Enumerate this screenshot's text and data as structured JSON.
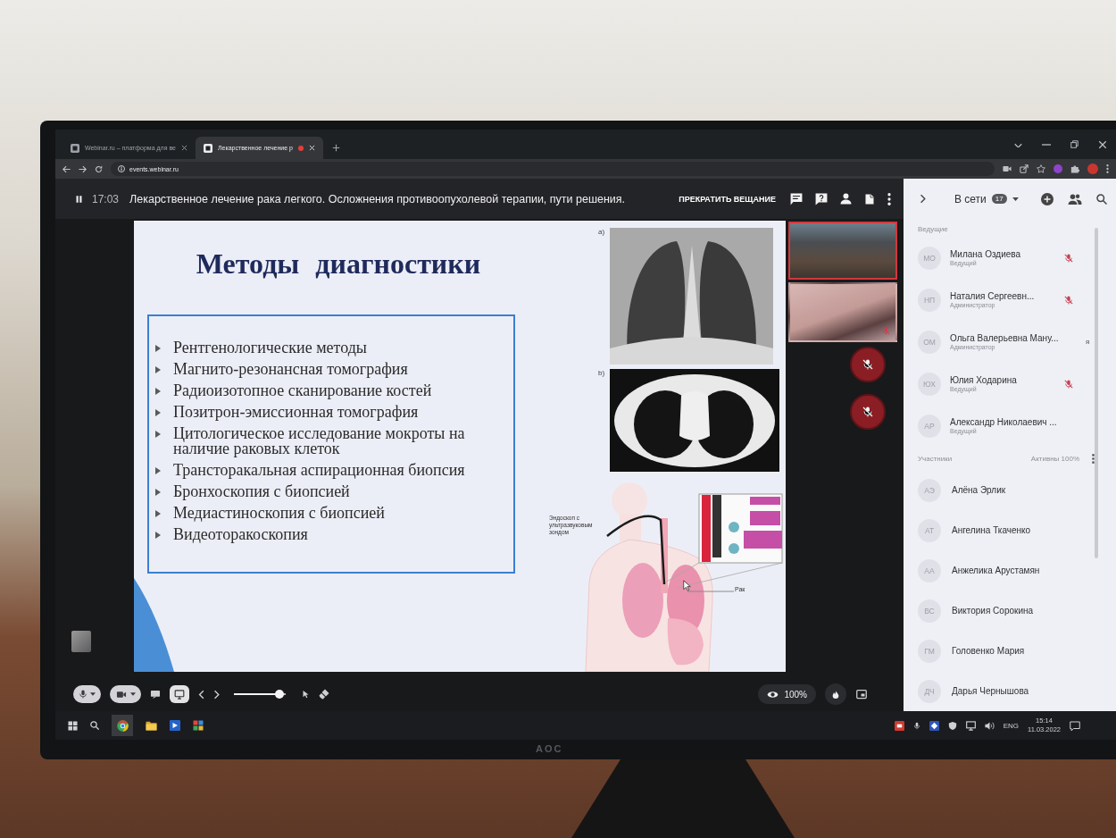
{
  "monitor": {
    "brand": "AOC"
  },
  "browser": {
    "tabs": [
      {
        "title": "Webinar.ru – платформа для ве",
        "selected": false,
        "recording": false
      },
      {
        "title": "Лекарственное лечение р",
        "selected": true,
        "recording": true
      }
    ],
    "address": "events.webinar.ru"
  },
  "top_bar": {
    "time": "17:03",
    "title": "Лекарственное лечение рака легкого. Осложнения противоопухолевой терапии, пути решения.",
    "stop_button": "ПРЕКРАТИТЬ ВЕЩАНИЕ"
  },
  "slide": {
    "title": "Методы диагностики",
    "bullets": [
      "Рентгенологические методы",
      "Магнито-резонансная томография",
      "Радиоизотопное сканирование костей",
      "Позитрон-эмиссионная томография",
      "Цитологическое исследование мокроты на наличие раковых клеток",
      "Трансторакальная аспирационная биопсия",
      "Бронхоскопия с биопсией",
      "Медиастиноскопия с биопсией",
      "Видеоторакоскопия"
    ],
    "figures": [
      {
        "kind": "xray",
        "label": "a)"
      },
      {
        "kind": "ct",
        "label": "b)"
      }
    ],
    "illustration": {
      "endoscope_label": "Эндоскоп с ультразвуковым зондом",
      "tumor_label": "Рак"
    }
  },
  "video_tiles": [
    {
      "kind": "video",
      "speaking": true,
      "mic_muted": false
    },
    {
      "kind": "video",
      "speaking": false,
      "mic_muted": true
    },
    {
      "kind": "audio",
      "speaking": false,
      "mic_muted": true
    },
    {
      "kind": "audio",
      "speaking": false,
      "mic_muted": true
    }
  ],
  "controls": {
    "slider": {
      "level": 0.95
    },
    "view_percent": "100%"
  },
  "sidebar": {
    "online_label": "В сети",
    "online_count": "17",
    "hosts_heading": "Ведущие",
    "hosts": [
      {
        "initials": "МО",
        "name": "Милана Оздиева",
        "role": "Ведущий",
        "mic_muted": true
      },
      {
        "initials": "НП",
        "name": "Наталия Сергеевн...",
        "role": "Администратор",
        "mic_muted": true
      },
      {
        "initials": "ОМ",
        "name": "Ольга Валерьевна Ману...",
        "role": "Администратор",
        "mic_muted": false,
        "badge": "я"
      },
      {
        "initials": "ЮХ",
        "name": "Юлия Ходарина",
        "role": "Ведущий",
        "mic_muted": true
      },
      {
        "initials": "АР",
        "name": "Александр Николаевич ...",
        "role": "Ведущий",
        "mic_muted": false
      }
    ],
    "participants_heading": "Участники",
    "activity": "Активны 100%",
    "participants": [
      {
        "initials": "АЭ",
        "name": "Алёна Эрлик"
      },
      {
        "initials": "АТ",
        "name": "Ангелина Ткаченко"
      },
      {
        "initials": "АА",
        "name": "Анжелика Арустамян"
      },
      {
        "initials": "ВС",
        "name": "Виктория Сорокина"
      },
      {
        "initials": "ГМ",
        "name": "Головенко Мария"
      },
      {
        "initials": "ДЧ",
        "name": "Дарья Чернышова"
      }
    ]
  },
  "taskbar": {
    "language": "ENG",
    "time": "15:14",
    "date": "11.03.2022"
  }
}
